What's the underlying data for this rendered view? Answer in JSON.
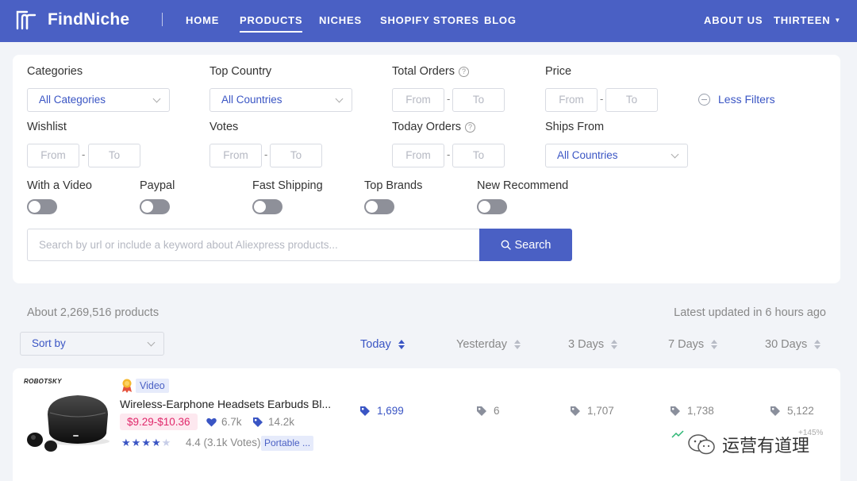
{
  "nav": {
    "brand": "FindNiche",
    "items": [
      {
        "label": "HOME",
        "active": false
      },
      {
        "label": "PRODUCTS",
        "active": true
      },
      {
        "label": "NICHES",
        "active": false
      },
      {
        "label": "SHOPIFY STORES",
        "active": false
      },
      {
        "label": "BLOG",
        "active": false
      }
    ],
    "about": "ABOUT US",
    "user": "THIRTEEN"
  },
  "filters": {
    "categories_label": "Categories",
    "categories_value": "All Categories",
    "top_country_label": "Top Country",
    "top_country_value": "All Countries",
    "total_orders_label": "Total Orders",
    "price_label": "Price",
    "wishlist_label": "Wishlist",
    "votes_label": "Votes",
    "today_orders_label": "Today Orders",
    "ships_from_label": "Ships From",
    "ships_from_value": "All Countries",
    "from_placeholder": "From",
    "to_placeholder": "To",
    "less_filters": "Less Filters",
    "toggles": [
      {
        "label": "With a Video",
        "on": false
      },
      {
        "label": "Paypal",
        "on": false
      },
      {
        "label": "Fast Shipping",
        "on": false
      },
      {
        "label": "Top Brands",
        "on": false
      },
      {
        "label": "New Recommend",
        "on": false
      }
    ],
    "search_placeholder": "Search by url or include a keyword about Aliexpress products...",
    "search_button": "Search"
  },
  "results": {
    "count_text": "About 2,269,516 products",
    "updated_text": "Latest updated in 6 hours ago",
    "sort_label": "Sort by",
    "columns": [
      "Today",
      "Yesterday",
      "3 Days",
      "7 Days",
      "30 Days"
    ]
  },
  "product": {
    "brand_mark": "ROBOTSKY",
    "video_tag": "Video",
    "title": "Wireless-Earphone Headsets Earbuds Bl...",
    "price": "$9.29-$10.36",
    "wishlist": "6.7k",
    "orders_total": "14.2k",
    "rating": 4.4,
    "rating_text": "4.4 (3.1k Votes)",
    "category": "Portable ...",
    "orders": [
      "1,699",
      "6",
      "1,707",
      "1,738",
      "5,122"
    ],
    "trend_value": "+145%"
  },
  "watermark": "运营有道理",
  "colors": {
    "nav_bg": "#4a60c4",
    "accent": "#3a55c4",
    "price_text": "#e0286b",
    "price_bg": "#fde8ef"
  }
}
